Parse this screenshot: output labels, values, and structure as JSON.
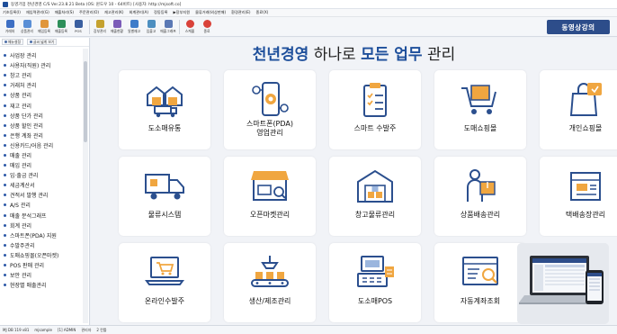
{
  "window": {
    "title": "동영기업 천년경영 C/S Ver.23.8.21 Beta (OS: 윈도우 10 - 64비트) [사용자: http://mjsoft.co]"
  },
  "menu": [
    "기초등록(I)",
    "재입력관리(G)",
    "매출처리(S)",
    "주문관리(O)",
    "재고관리(K)",
    "회계관리(A)",
    "정동등록",
    "▶장부지원",
    "물류거래(외상판매)",
    "환경관리(E)",
    "종료(X)"
  ],
  "toolbar": {
    "buttons": [
      {
        "label": "거래처",
        "color": "#3d6fc4"
      },
      {
        "label": "상품관리",
        "color": "#5a8fd6"
      },
      {
        "label": "매입등록",
        "color": "#e0963a"
      },
      {
        "label": "매출등록",
        "color": "#2d8f5a"
      },
      {
        "label": "POS",
        "color": "#3a5fa0"
      },
      {
        "label": "장부관리",
        "color": "#c5a230"
      },
      {
        "label": "매출현황",
        "color": "#7b5cb8"
      },
      {
        "label": "일별재고",
        "color": "#3e7cc9"
      },
      {
        "label": "입출고",
        "color": "#4d8fc0"
      },
      {
        "label": "매출그래프",
        "color": "#5b79b5"
      },
      {
        "label": "스케줄",
        "color": "#d9423a"
      },
      {
        "label": "종료",
        "color": "#d9423a"
      }
    ],
    "brand": "동영상강의"
  },
  "sidebar": {
    "top_buttons": [
      "메뉴설정",
      "글씨 넓게 보기"
    ],
    "items": [
      "사업장 관리",
      "사용자(직원) 관리",
      "창고 관리",
      "거래처 관리",
      "상품 관리",
      "재고 관리",
      "상품 단가 관리",
      "상품 할인 관리",
      "은행 계좌 관리",
      "신용카드/어음 관리",
      "매출 관리",
      "매입 관리",
      "입·출금 관리",
      "세금계산서",
      "견적서 발행 관리",
      "A/S 관리",
      "매출 분석그래프",
      "회계 관리",
      "스마트폰(PDA) 지원",
      "수발주관리",
      "도매쇼핑몰(오픈마켓)",
      "POS 판매 관리",
      "보안 관리",
      "현장별 매출관리"
    ]
  },
  "main": {
    "headline": {
      "p1": "천년경영",
      "p2": " 하나로 ",
      "p3": "모든 업무",
      "p4": " 관리"
    },
    "tiles": [
      {
        "label": "도소매유통",
        "icon": "warehouse-truck-icon"
      },
      {
        "label": "스마트폰(PDA)\n영업관리",
        "icon": "smartphone-gear-icon"
      },
      {
        "label": "스마트 수발주",
        "icon": "clipboard-checklist-icon"
      },
      {
        "label": "도매쇼핑몰",
        "icon": "shopping-cart-box-icon"
      },
      {
        "label": "개인쇼핑몰",
        "icon": "shopping-bag-icon"
      },
      {
        "label": "물류시스템",
        "icon": "delivery-truck-icon"
      },
      {
        "label": "오픈마켓관리",
        "icon": "storefront-icon"
      },
      {
        "label": "창고물류관리",
        "icon": "warehouse-icon"
      },
      {
        "label": "상품배송관리",
        "icon": "delivery-person-icon"
      },
      {
        "label": "택배송장관리",
        "icon": "parcel-box-icon"
      },
      {
        "label": "온라인수발주",
        "icon": "laptop-cart-icon"
      },
      {
        "label": "생산/제조관리",
        "icon": "conveyor-belt-icon"
      },
      {
        "label": "도소매POS",
        "icon": "pos-terminal-icon"
      },
      {
        "label": "자동계좌조회",
        "icon": "bank-account-search-icon"
      }
    ],
    "accent": "#1e4f9b"
  },
  "statusbar": [
    "MJ DB 119 v81",
    "mjsample",
    "[1] ADMIN",
    "관리자",
    "2 칸틀"
  ]
}
